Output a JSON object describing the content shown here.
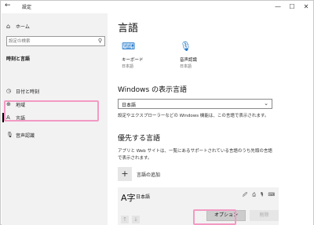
{
  "window": {
    "title": "設定",
    "back_icon": "back-arrow-icon",
    "controls": [
      "—",
      "☐",
      "✕"
    ]
  },
  "sidebar": {
    "home": {
      "label": "ホーム",
      "icon": "home-icon"
    },
    "search": {
      "placeholder": "設定の検索",
      "icon": "search-icon"
    },
    "section": "時刻と言語",
    "items": [
      {
        "label": "日付と時刻",
        "icon": "calendar-clock-icon"
      },
      {
        "label": "地域",
        "icon": "globe-icon"
      },
      {
        "label": "言語",
        "icon": "language-icon",
        "active": true
      },
      {
        "label": "音声認識",
        "icon": "microphone-icon"
      }
    ]
  },
  "main": {
    "title": "言語",
    "tiles": [
      {
        "label": "キーボード",
        "sub": "日本語",
        "icon": "keyboard-icon"
      },
      {
        "label": "音声認識",
        "sub": "日本語",
        "icon": "microphone-icon"
      }
    ],
    "display_language": {
      "heading": "Windows の表示言語",
      "selected": "日本語",
      "description": "設定やエクスプローラーなどの Windows 機能は、この言語で表示されます。"
    },
    "preferred": {
      "heading": "優先する言語",
      "description": "アプリと Web サイトは、一覧にあるサポートされている言語のうち先頭の言語で表示されます。",
      "add_label": "言語の追加",
      "language": {
        "name": "日本語",
        "feature_icons": "🖉 ⎙ 🎙 ⌨"
      },
      "options_label": "オプション",
      "remove_label": "削除"
    }
  },
  "colors": {
    "highlight": "#f29ac3",
    "accent": "#1a73c8",
    "sidebar_bg": "#f2f2f2"
  }
}
